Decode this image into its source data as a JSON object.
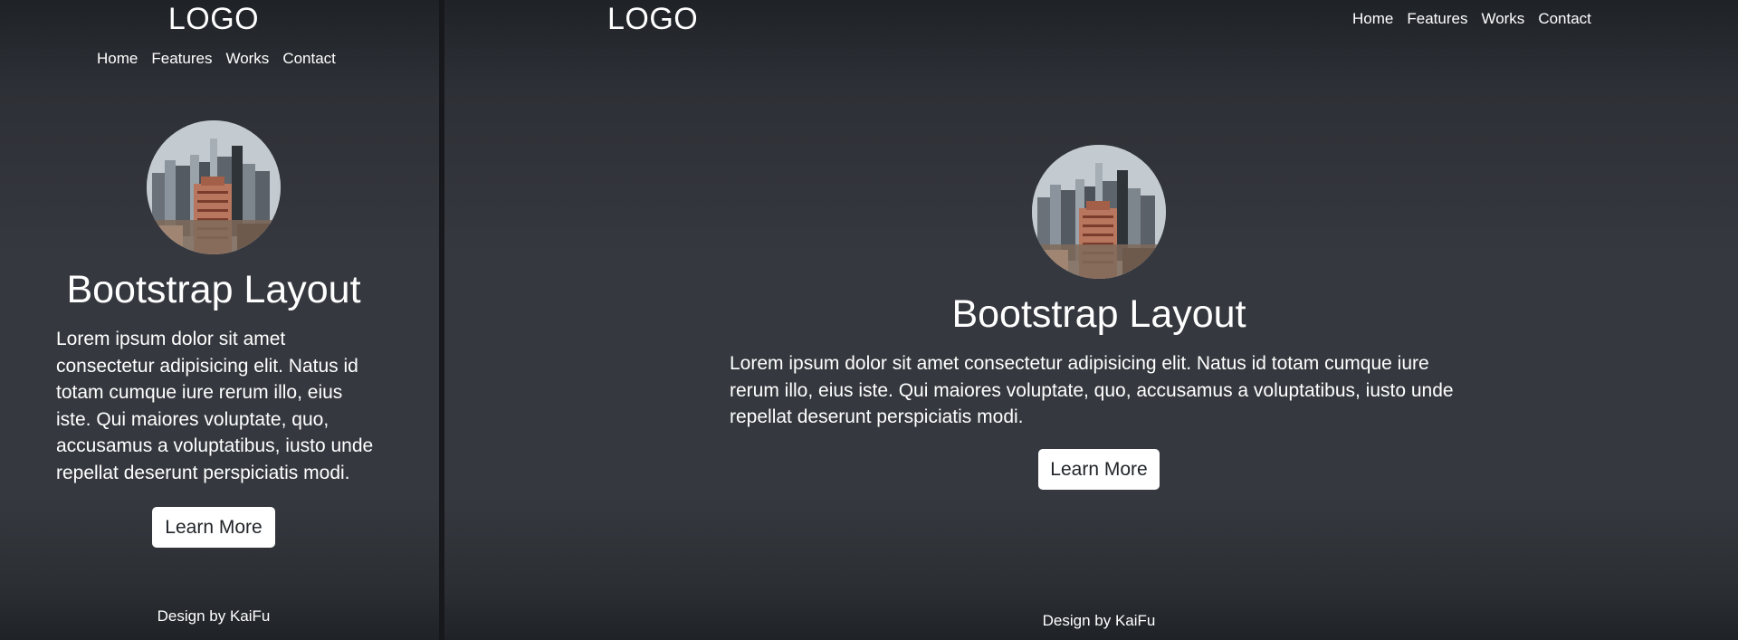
{
  "brand": {
    "logo": "LOGO"
  },
  "nav": {
    "items": [
      "Home",
      "Features",
      "Works",
      "Contact"
    ]
  },
  "hero": {
    "avatar_alt": "city skyline",
    "title": "Bootstrap Layout",
    "lead": "Lorem ipsum dolor sit amet consectetur adipisicing elit. Natus id totam cumque iure rerum illo, eius iste. Qui maiores voluptate, quo, accusamus a voluptatibus, iusto unde repellat deserunt perspiciatis modi.",
    "button_label": "Learn More"
  },
  "footer": {
    "credit": "Design by KaiFu"
  },
  "colors": {
    "page_bg": "#35383e",
    "text": "#ffffff",
    "button_bg": "#ffffff",
    "button_text": "#212529"
  }
}
